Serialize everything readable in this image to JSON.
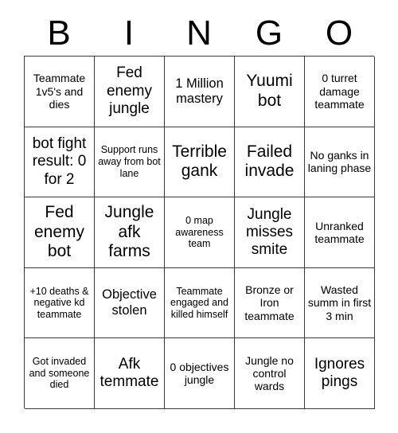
{
  "card": {
    "title": "BINGO",
    "columns": [
      "B",
      "I",
      "N",
      "G",
      "O"
    ],
    "grid_size": "5x5",
    "border_color": "#3a3a3a",
    "background_color": "#ffffff",
    "text_color": "#000000"
  },
  "header": {
    "letters": [
      {
        "label": "B"
      },
      {
        "label": "I"
      },
      {
        "label": "N"
      },
      {
        "label": "G"
      },
      {
        "label": "O"
      }
    ]
  },
  "rows": [
    {
      "cells": [
        {
          "text": "Teammate 1v5's and dies",
          "size": "sm"
        },
        {
          "text": "Fed enemy jungle",
          "size": "lg"
        },
        {
          "text": "1 Million mastery",
          "size": "md"
        },
        {
          "text": "Yuumi bot",
          "size": "xl"
        },
        {
          "text": "0 turret damage teammate",
          "size": "sm"
        }
      ]
    },
    {
      "cells": [
        {
          "text": "bot fight result: 0 for 2",
          "size": "lg"
        },
        {
          "text": "Support runs away from bot lane",
          "size": "xs"
        },
        {
          "text": "Terrible gank",
          "size": "xl"
        },
        {
          "text": "Failed invade",
          "size": "xl"
        },
        {
          "text": "No ganks in laning phase",
          "size": "sm"
        }
      ]
    },
    {
      "cells": [
        {
          "text": "Fed enemy bot",
          "size": "xl"
        },
        {
          "text": "Jungle afk farms",
          "size": "xl"
        },
        {
          "text": "0 map awareness team",
          "size": "xs"
        },
        {
          "text": "Jungle misses smite",
          "size": "lg"
        },
        {
          "text": "Unranked teammate",
          "size": "sm"
        }
      ]
    },
    {
      "cells": [
        {
          "text": "+10 deaths & negative kd teammate",
          "size": "xs"
        },
        {
          "text": "Objective stolen",
          "size": "md"
        },
        {
          "text": "Teammate engaged and killed himself",
          "size": "xs"
        },
        {
          "text": "Bronze or Iron teammate",
          "size": "sm"
        },
        {
          "text": "Wasted summ in first 3 min",
          "size": "sm"
        }
      ]
    },
    {
      "cells": [
        {
          "text": "Got invaded and someone died",
          "size": "xs"
        },
        {
          "text": "Afk temmate",
          "size": "lg"
        },
        {
          "text": "0 objectives jungle",
          "size": "sm"
        },
        {
          "text": "Jungle no control wards",
          "size": "sm"
        },
        {
          "text": "Ignores pings",
          "size": "lg"
        }
      ]
    }
  ]
}
